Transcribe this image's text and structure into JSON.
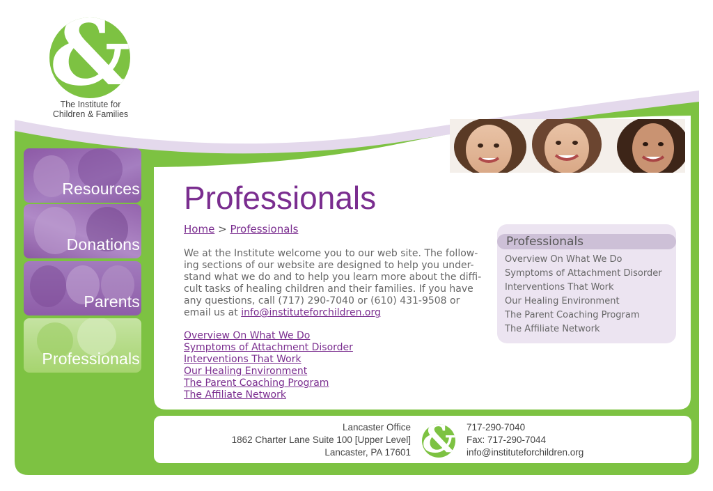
{
  "logo": {
    "glyph": "&",
    "tagline_line1": "The Institute for",
    "tagline_line2": "Children & Families"
  },
  "nav": [
    {
      "label": "Resources"
    },
    {
      "label": "Donations"
    },
    {
      "label": "Parents"
    },
    {
      "label": "Professionals"
    }
  ],
  "main": {
    "title": "Professionals",
    "breadcrumb": {
      "home": "Home",
      "separator": ">",
      "current": "Professionals"
    },
    "intro_lines": [
      "We at the Institute welcome you to our web site. The follow-",
      "ing sections of our website are designed to help you under-",
      "stand what we do and to help you learn more about the diffi-",
      "cult tasks of healing children and their families. If you have",
      "any questions, call (717) 290-7040 or (610) 431-9508 or",
      "email us at "
    ],
    "email": "info@instituteforchildren.org",
    "links": [
      "Overview On What We Do",
      "Symptoms of Attachment Disorder",
      "Interventions That Work",
      "Our Healing Environment",
      "The Parent Coaching Program",
      "The Affiliate Network"
    ]
  },
  "panel": {
    "title": "Professionals",
    "items": [
      "Overview On What We Do",
      "Symptoms of Attachment Disorder",
      "Interventions That Work",
      "Our Healing Environment",
      "The Parent Coaching Program",
      "The Affiliate Network"
    ]
  },
  "footer": {
    "office": "Lancaster Office",
    "address": "1862 Charter Lane Suite 100 [Upper Level]",
    "city": "Lancaster, PA 17601",
    "phone": "717-290-7040",
    "fax": "Fax: 717-290-7044",
    "email": "info@instituteforchildren.org",
    "logo_glyph": "&"
  },
  "colors": {
    "brand_green": "#7dc242",
    "brand_purple": "#7a2d8f",
    "lavender": "#ece4f1"
  }
}
